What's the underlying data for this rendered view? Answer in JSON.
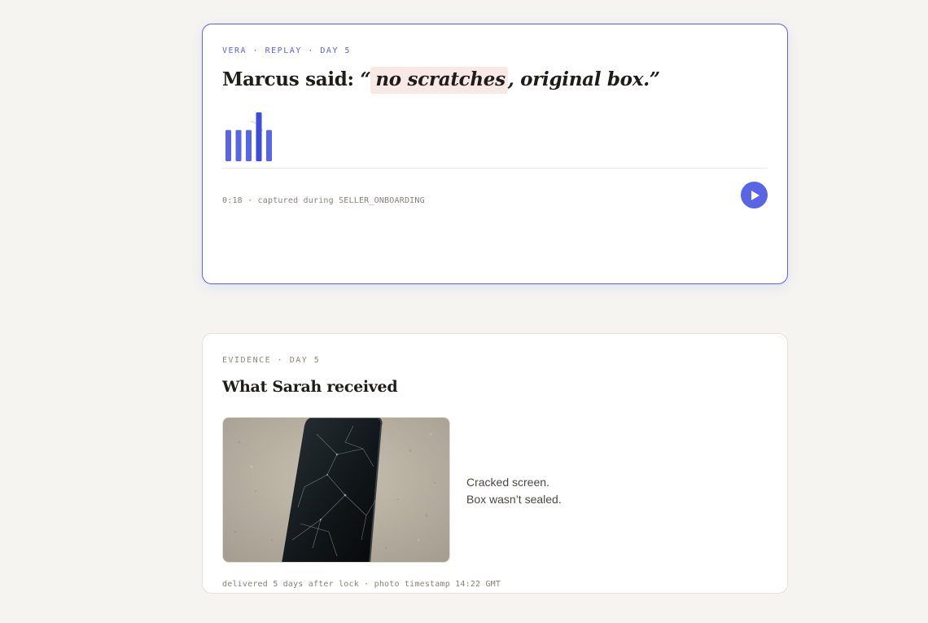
{
  "replay": {
    "eyebrow": "VERA · REPLAY · DAY 5",
    "headline_prefix": "Marcus said: ",
    "quote_open": "“",
    "quote_highlight": "no scratches",
    "quote_rest": ", original box.”",
    "waveform_levels": [
      0.64,
      0.64,
      0.64,
      1.0,
      0.64
    ],
    "meta": "0:18 · captured during SELLER_ONBOARDING",
    "play_icon": "play-icon",
    "accent_color": "#5865e6",
    "highlight_color": "#f8e9e6"
  },
  "evidence": {
    "eyebrow": "EVIDENCE · DAY 5",
    "title": "What Sarah received",
    "caption_line1": "Cracked screen.",
    "caption_line2": "Box wasn’t sealed.",
    "meta": "delivered 5 days after lock · photo timestamp 14:22 GMT"
  }
}
